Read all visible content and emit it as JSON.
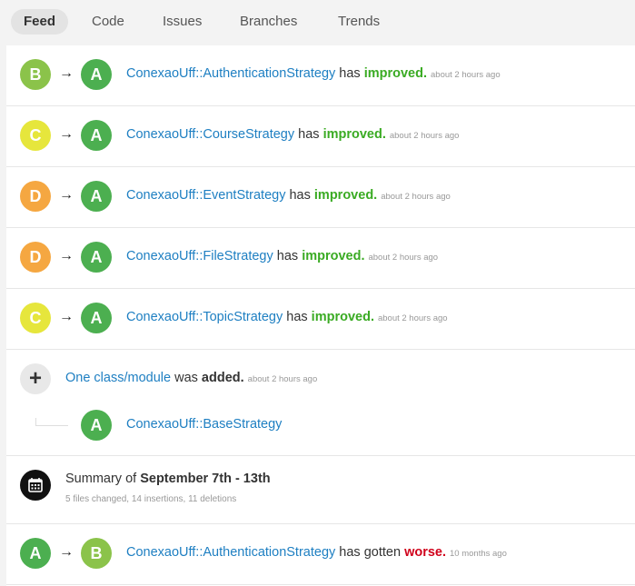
{
  "colors": {
    "grade_A": "#4caf50",
    "grade_B": "#8bc34a",
    "grade_C": "#e6e63c",
    "grade_D": "#f5a741",
    "link": "#1e7fc2",
    "improved": "#3aab23",
    "worse": "#d0021b"
  },
  "tabs": [
    {
      "label": "Feed",
      "active": true
    },
    {
      "label": "Code",
      "active": false
    },
    {
      "label": "Issues",
      "active": false
    },
    {
      "label": "Branches",
      "active": false
    },
    {
      "label": "Trends",
      "active": false
    }
  ],
  "feed": {
    "arrow": "→",
    "items": [
      {
        "from": "B",
        "to": "A",
        "name": "ConexaoUff::AuthenticationStrategy",
        "verb": "has",
        "result": "improved",
        "time": "about 2 hours ago"
      },
      {
        "from": "C",
        "to": "A",
        "name": "ConexaoUff::CourseStrategy",
        "verb": "has",
        "result": "improved",
        "time": "about 2 hours ago"
      },
      {
        "from": "D",
        "to": "A",
        "name": "ConexaoUff::EventStrategy",
        "verb": "has",
        "result": "improved",
        "time": "about 2 hours ago"
      },
      {
        "from": "D",
        "to": "A",
        "name": "ConexaoUff::FileStrategy",
        "verb": "has",
        "result": "improved",
        "time": "about 2 hours ago"
      },
      {
        "from": "C",
        "to": "A",
        "name": "ConexaoUff::TopicStrategy",
        "verb": "has",
        "result": "improved",
        "time": "about 2 hours ago"
      }
    ],
    "added": {
      "plus_icon": "+",
      "link": "One class/module",
      "text": "was",
      "strong": "added",
      "time": "about 2 hours ago",
      "child_grade": "A",
      "child_name": "ConexaoUff::BaseStrategy"
    },
    "summary": {
      "prefix": "Summary of",
      "range": "September 7th - 13th",
      "stats": "5 files changed, 14 insertions, 11 deletions"
    },
    "worse_item": {
      "from": "A",
      "to": "B",
      "name": "ConexaoUff::AuthenticationStrategy",
      "verb": "has gotten",
      "result": "worse",
      "time": "10 months ago"
    }
  }
}
